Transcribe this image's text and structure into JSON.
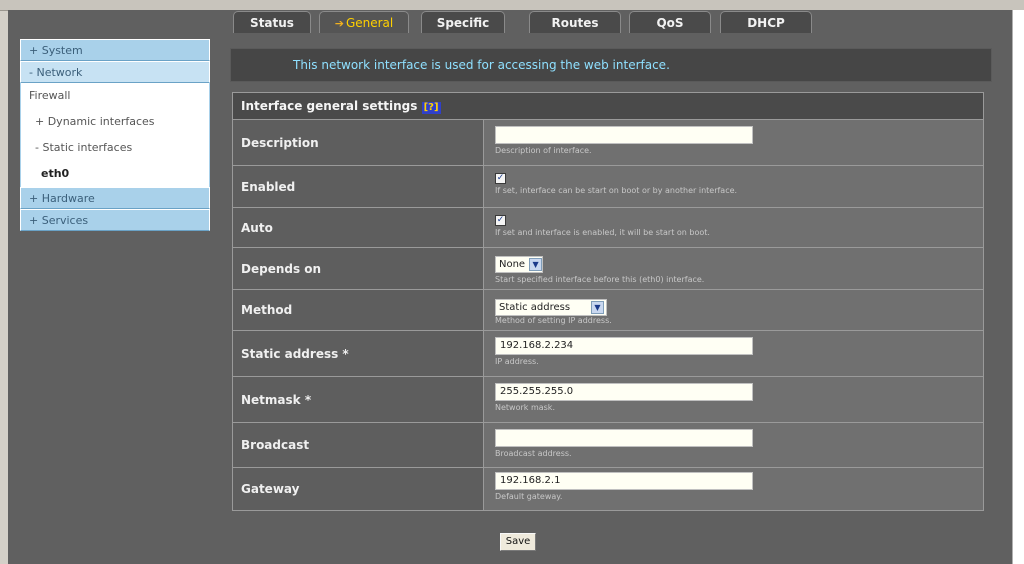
{
  "tabs": [
    {
      "label": "Status"
    },
    {
      "label": "General"
    },
    {
      "label": "Specific"
    },
    {
      "label": "Routes"
    },
    {
      "label": "QoS"
    },
    {
      "label": "DHCP"
    }
  ],
  "banner": "This network interface is used for accessing the web interface.",
  "sidebar": {
    "system": "+ System",
    "network": "- Network",
    "firewall": "Firewall",
    "dynamic": "+ Dynamic interfaces",
    "static": "- Static interfaces",
    "eth0": "eth0",
    "hardware": "+ Hardware",
    "services": "+ Services"
  },
  "form": {
    "header": "Interface general settings",
    "help": "[?]",
    "description": {
      "label": "Description",
      "value": "",
      "hint": "Description of interface."
    },
    "enabled": {
      "label": "Enabled",
      "mark": "✓",
      "hint": "If set, interface can be start on boot or by another interface."
    },
    "auto": {
      "label": "Auto",
      "mark": "✓",
      "hint": "If set and interface is enabled, it will be start on boot."
    },
    "depends_on": {
      "label": "Depends on",
      "value": "None",
      "hint": "Start specified interface before this (eth0) interface."
    },
    "method": {
      "label": "Method",
      "value": "Static address",
      "hint": "Method of setting IP address."
    },
    "static_address": {
      "label": "Static address *",
      "value": "192.168.2.234",
      "hint": "IP address."
    },
    "netmask": {
      "label": "Netmask *",
      "value": "255.255.255.0",
      "hint": "Network mask."
    },
    "broadcast": {
      "label": "Broadcast",
      "value": "",
      "hint": "Broadcast address."
    },
    "gateway": {
      "label": "Gateway",
      "value": "192.168.2.1",
      "hint": "Default gateway."
    }
  },
  "save_label": "Save",
  "colors": {
    "banner_text": "#8fe0ff",
    "selected_tab": "#ffd000",
    "sidebar": "#a9d1ea",
    "background": "#606060"
  }
}
